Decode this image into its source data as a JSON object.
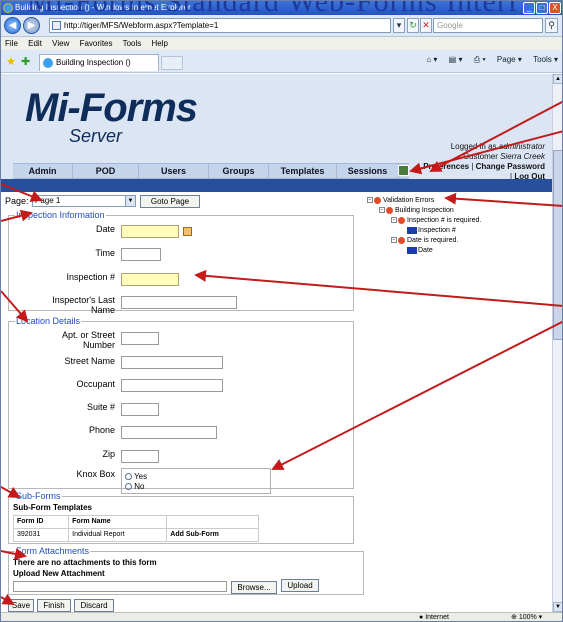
{
  "overlay_title": "Mi-Forms Standard Web-Forms Interf",
  "window": {
    "title": "Building Inspection () - Windows Internet Explorer",
    "controls": [
      "_",
      "□",
      "X"
    ]
  },
  "browser": {
    "address": "http://tiger/MFS/Webform.aspx?Template=1",
    "search_placeholder": "Google",
    "menu": [
      "File",
      "Edit",
      "View",
      "Favorites",
      "Tools",
      "Help"
    ],
    "tab_title": "Building Inspection ()",
    "tools": [
      "Page ▾",
      "Tools ▾"
    ],
    "status": {
      "zone": "Internet",
      "zoom": "100%"
    }
  },
  "app": {
    "logo_main": "Mi-Forms",
    "logo_sub": "Server",
    "logged_line1_pre": "Logged in as ",
    "logged_user": "administrator",
    "logged_line2_pre": "Customer ",
    "logged_customer": "Sierra Creek",
    "preferences": "Preferences",
    "change_password": "Change Password",
    "logout": "Log Out",
    "nav": [
      "Admin",
      "POD",
      "Users",
      "Groups",
      "Templates",
      "Sessions"
    ]
  },
  "page_select": {
    "label": "Page:",
    "value": "Page 1",
    "goto": "Goto Page"
  },
  "inspection": {
    "legend": "Inspection Information",
    "date_label": "Date",
    "time_label": "Time",
    "number_label": "Inspection #",
    "inspector_label": "Inspector's Last Name"
  },
  "location": {
    "legend": "Location Details",
    "apt_label": "Apt. or Street Number",
    "street_label": "Street Name",
    "occupant_label": "Occupant",
    "suite_label": "Suite #",
    "phone_label": "Phone",
    "zip_label": "Zip",
    "knox_label": "Knox Box",
    "knox_options": [
      "Yes",
      "No"
    ]
  },
  "subforms": {
    "legend": "Sub-Forms",
    "heading": "Sub-Form Templates",
    "col_id": "Form ID",
    "col_name": "Form Name",
    "rows": [
      {
        "id": "392031",
        "name": "Individual Report",
        "action": "Add Sub-Form"
      }
    ]
  },
  "attachments": {
    "legend": "Form Attachments",
    "none_text": "There are no attachments to this form",
    "upload_heading": "Upload New Attachment",
    "browse": "Browse...",
    "upload": "Upload"
  },
  "actions": {
    "save": "Save",
    "finish": "Finish",
    "discard": "Discard"
  },
  "validation": {
    "root": "Validation Errors",
    "form": "Building Inspection",
    "errors": [
      {
        "message": "Inspection # is required.",
        "field": "Inspection #"
      },
      {
        "message": "Date is required.",
        "field": "Date"
      }
    ]
  }
}
